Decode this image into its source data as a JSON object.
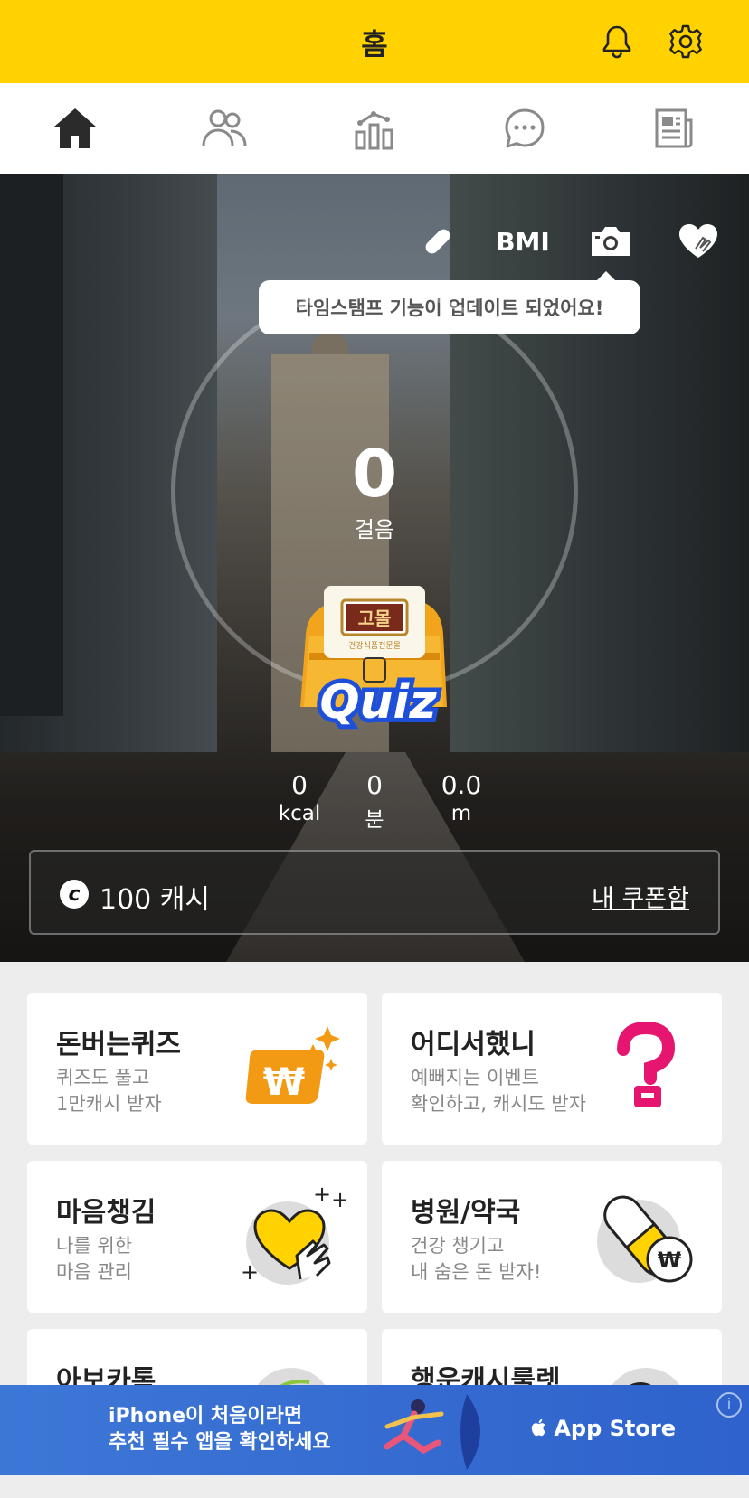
{
  "header": {
    "title": "홈"
  },
  "nav": {
    "items": [
      "home",
      "friends",
      "stats",
      "chat",
      "news"
    ]
  },
  "hero": {
    "tools": {
      "bmi_label": "BMI"
    },
    "tooltip": "타임스탬프 기능이 업데이트 되었어요!",
    "steps": {
      "value": "0",
      "label": "걸음"
    },
    "quiz_badge": {
      "label": "Quiz",
      "brand": "고몰",
      "brand_sub": "건강식품전문몰"
    },
    "stats": [
      {
        "value": "0",
        "unit": "kcal"
      },
      {
        "value": "0",
        "unit": "분"
      },
      {
        "value": "0.0",
        "unit": "m"
      }
    ],
    "cash": {
      "coin_symbol": "c",
      "amount": "100 캐시",
      "coupon_link": "내 쿠폰함"
    }
  },
  "cards": [
    {
      "title": "돈버는퀴즈",
      "subtitle": [
        "퀴즈도 풀고",
        "1만캐시 받자"
      ],
      "icon": "won-sparkle-icon"
    },
    {
      "title": "어디서했니",
      "subtitle": [
        "예뻐지는 이벤트",
        "확인하고, 캐시도 받자"
      ],
      "icon": "pink-question-icon"
    },
    {
      "title": "마음챙김",
      "subtitle": [
        "나를 위한",
        "마음 관리"
      ],
      "icon": "heart-hand-icon"
    },
    {
      "title": "병원/약국",
      "subtitle": [
        "건강 챙기고",
        "내 숨은 돈 받자!"
      ],
      "icon": "pill-won-icon"
    },
    {
      "title": "아보카톡",
      "subtitle": [],
      "icon": "avocado-icon"
    },
    {
      "title": "행운캐시룰렛",
      "subtitle": [],
      "icon": "coin-icon"
    }
  ],
  "banner": {
    "line1": "iPhone이 처음이라면",
    "line2": "추천 필수 앱을 확인하세요",
    "store": "App Store",
    "info": "i"
  },
  "colors": {
    "brand_yellow": "#ffd200",
    "quiz_blue": "#1d4fd8",
    "ad_blue": "#3d77d6",
    "pink": "#e6156f"
  }
}
